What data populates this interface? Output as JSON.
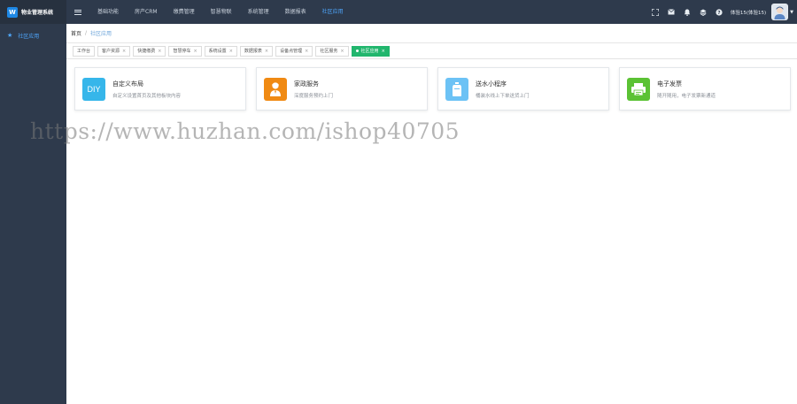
{
  "app": {
    "logo_mark": "W",
    "title": "物业管理系统"
  },
  "topnav": {
    "items": [
      {
        "label": "基础功能",
        "active": false
      },
      {
        "label": "房产CRM",
        "active": false
      },
      {
        "label": "缴费管理",
        "active": false
      },
      {
        "label": "智慧物联",
        "active": false
      },
      {
        "label": "系统管理",
        "active": false
      },
      {
        "label": "数据报表",
        "active": false
      },
      {
        "label": "社区应用",
        "active": true
      }
    ]
  },
  "header_right": {
    "icons": [
      "fullscreen-icon",
      "mail-icon",
      "bell-icon",
      "layers-icon",
      "help-icon"
    ],
    "user_name": "体验15(体验15)"
  },
  "sidebar": {
    "items": [
      {
        "label": "社区应用",
        "icon": "star-icon"
      }
    ]
  },
  "breadcrumb": {
    "home": "首页",
    "separator": "/",
    "current": "社区应用"
  },
  "tabs": [
    {
      "label": "工作台",
      "closable": false,
      "active": false
    },
    {
      "label": "客户资源",
      "closable": true,
      "active": false
    },
    {
      "label": "快捷缴费",
      "closable": true,
      "active": false
    },
    {
      "label": "智慧停车",
      "closable": true,
      "active": false
    },
    {
      "label": "系统设置",
      "closable": true,
      "active": false
    },
    {
      "label": "数据报表",
      "closable": true,
      "active": false
    },
    {
      "label": "设备点管理",
      "closable": true,
      "active": false
    },
    {
      "label": "社区服务",
      "closable": true,
      "active": false
    },
    {
      "label": "社区应用",
      "closable": true,
      "active": true
    }
  ],
  "cards": [
    {
      "title": "自定义布局",
      "desc": "自定义设置首页及其他板块内容",
      "icon": "diy-icon",
      "icon_text": "DIY",
      "color": "#36b6ea"
    },
    {
      "title": "家政服务",
      "desc": "深度服务预约上门",
      "icon": "housekeeper-icon",
      "color": "#f08a13"
    },
    {
      "title": "送水小程序",
      "desc": "桶装水线上下单送货上门",
      "icon": "water-bucket-icon",
      "color": "#6cc2f5"
    },
    {
      "title": "电子发票",
      "desc": "随开随用，电子发票新通道",
      "icon": "invoice-printer-icon",
      "color": "#5bc234"
    }
  ],
  "watermark": "https://www.huzhan.com/ishop40705",
  "colors": {
    "topbar": "#2e3a4c",
    "accent": "#4fa8ff",
    "active_tab": "#21b66d"
  }
}
